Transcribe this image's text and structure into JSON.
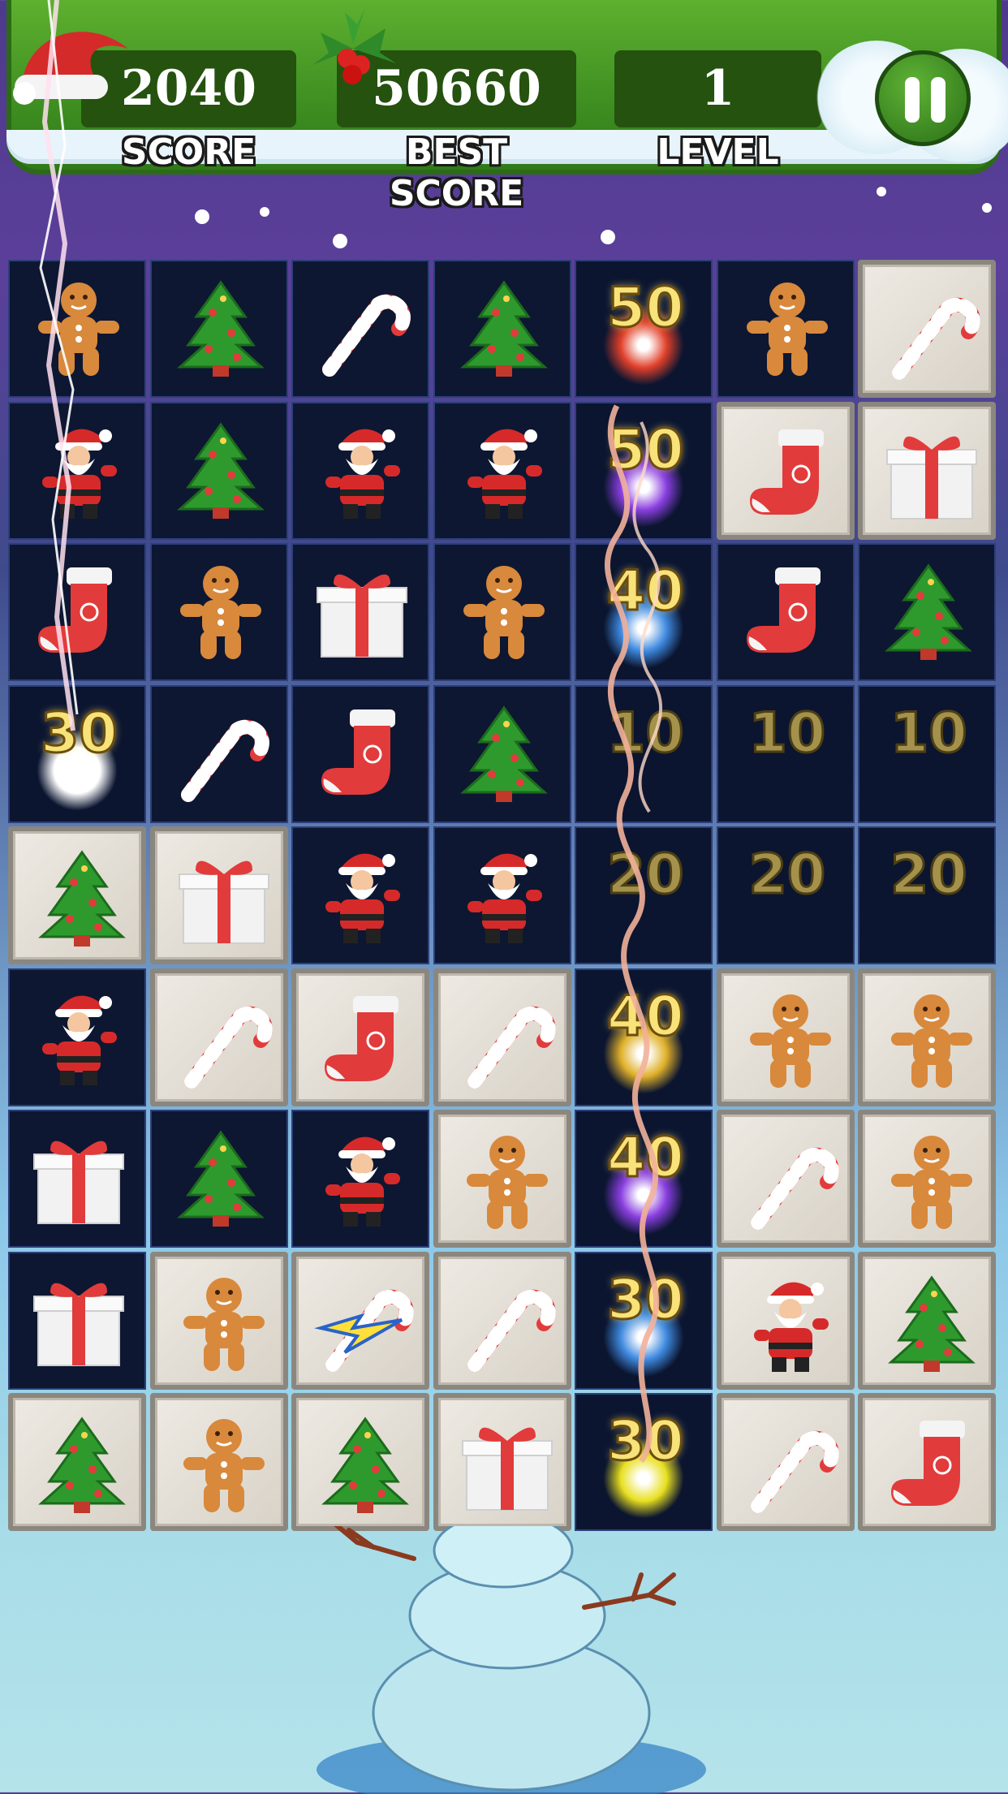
{
  "header": {
    "score": {
      "value": "2040",
      "label": "SCORE"
    },
    "best_score": {
      "value": "50660",
      "label": "BEST SCORE"
    },
    "level": {
      "value": "1",
      "label": "LEVEL"
    },
    "pause_icon": "pause-icon"
  },
  "board": {
    "columns": 7,
    "rows": 9,
    "grid": [
      [
        "gingerbread",
        "tree",
        "candy-cane",
        "tree",
        "empty",
        "gingerbread",
        "candy-cane"
      ],
      [
        "santa",
        "tree",
        "santa",
        "santa",
        "empty",
        "stocking",
        "gift"
      ],
      [
        "stocking",
        "gingerbread",
        "gift",
        "gingerbread",
        "empty",
        "stocking",
        "tree"
      ],
      [
        "empty",
        "candy-cane",
        "stocking",
        "tree",
        "empty",
        "empty",
        "empty"
      ],
      [
        "tree",
        "gift",
        "santa",
        "santa",
        "empty",
        "empty",
        "empty"
      ],
      [
        "santa",
        "candy-cane",
        "stocking",
        "candy-cane",
        "empty",
        "gingerbread",
        "gingerbread"
      ],
      [
        "gift",
        "tree",
        "santa",
        "gingerbread",
        "empty",
        "candy-cane",
        "gingerbread"
      ],
      [
        "gift",
        "gingerbread",
        "lightning-candy-cane",
        "candy-cane",
        "empty",
        "santa",
        "tree"
      ],
      [
        "tree",
        "gingerbread",
        "tree",
        "gift",
        "empty",
        "candy-cane",
        "stocking"
      ]
    ],
    "tile_background": [
      [
        "dark",
        "dark",
        "dark",
        "dark",
        "dark",
        "dark",
        "tile"
      ],
      [
        "dark",
        "dark",
        "dark",
        "dark",
        "dark",
        "tile",
        "tile"
      ],
      [
        "dark",
        "dark",
        "dark",
        "dark",
        "dark",
        "dark",
        "dark"
      ],
      [
        "dark",
        "dark",
        "dark",
        "dark",
        "dark",
        "dark",
        "dark"
      ],
      [
        "tile",
        "tile",
        "dark",
        "dark",
        "dark",
        "dark",
        "dark"
      ],
      [
        "dark",
        "tile",
        "tile",
        "tile",
        "dark",
        "tile",
        "tile"
      ],
      [
        "dark",
        "dark",
        "dark",
        "tile",
        "dark",
        "tile",
        "tile"
      ],
      [
        "dark",
        "tile",
        "tile",
        "tile",
        "dark",
        "tile",
        "tile"
      ],
      [
        "tile",
        "tile",
        "tile",
        "tile",
        "dark",
        "tile",
        "tile"
      ]
    ],
    "score_popups": [
      {
        "row": 0,
        "col": 4,
        "text": "50",
        "faded": false,
        "burst": "#e0402a"
      },
      {
        "row": 1,
        "col": 4,
        "text": "50",
        "faded": false,
        "burst": "#8a3fe0"
      },
      {
        "row": 2,
        "col": 4,
        "text": "40",
        "faded": false,
        "burst": "#3f8ae0"
      },
      {
        "row": 3,
        "col": 0,
        "text": "30",
        "faded": false,
        "burst": "#ffffff"
      },
      {
        "row": 3,
        "col": 4,
        "text": "10",
        "faded": true,
        "burst": ""
      },
      {
        "row": 3,
        "col": 5,
        "text": "10",
        "faded": true,
        "burst": ""
      },
      {
        "row": 3,
        "col": 6,
        "text": "10",
        "faded": true,
        "burst": ""
      },
      {
        "row": 4,
        "col": 4,
        "text": "20",
        "faded": true,
        "burst": ""
      },
      {
        "row": 4,
        "col": 5,
        "text": "20",
        "faded": true,
        "burst": ""
      },
      {
        "row": 4,
        "col": 6,
        "text": "20",
        "faded": true,
        "burst": ""
      },
      {
        "row": 5,
        "col": 4,
        "text": "40",
        "faded": false,
        "burst": "#e0b02a"
      },
      {
        "row": 6,
        "col": 4,
        "text": "40",
        "faded": false,
        "burst": "#8a3fe0"
      },
      {
        "row": 7,
        "col": 4,
        "text": "30",
        "faded": false,
        "burst": "#3f8ae0"
      },
      {
        "row": 8,
        "col": 4,
        "text": "30",
        "faded": false,
        "burst": "#e8e020"
      }
    ]
  },
  "colors": {
    "header_green": "#3f8f22",
    "stat_box": "#25520f",
    "board_cell": "#0d1732",
    "points_gold": "#f8e27a"
  }
}
